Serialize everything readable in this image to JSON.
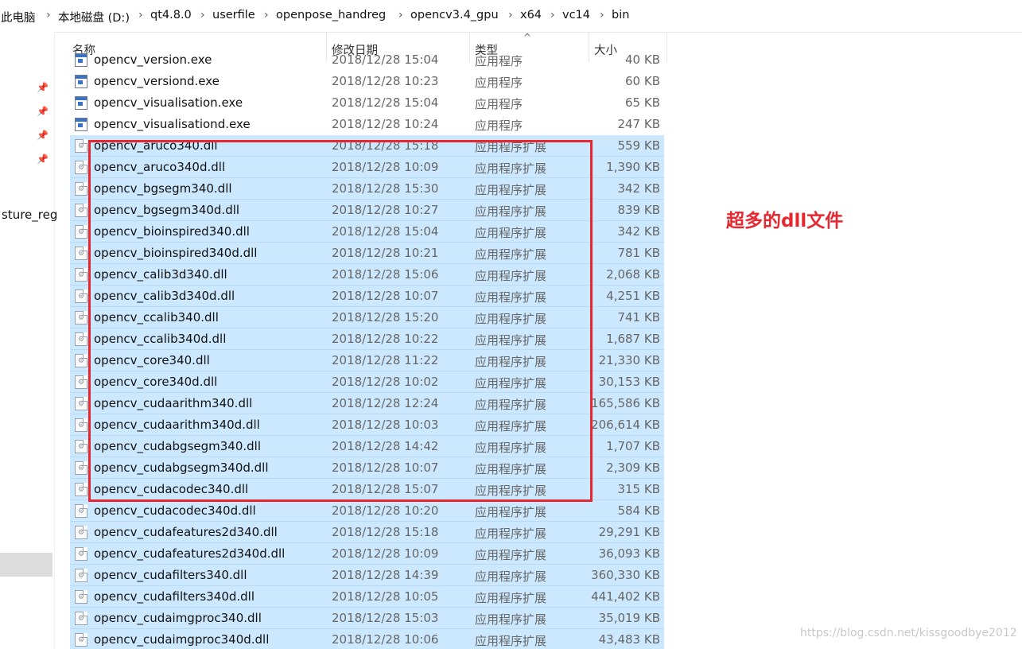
{
  "breadcrumb": [
    "此电脑",
    "本地磁盘 (D:)",
    "qt4.8.0",
    "userfile",
    "openpose_handreg",
    "opencv3.4_gpu",
    "x64",
    "vc14",
    "bin"
  ],
  "nav": {
    "partial_item": "sture_reg"
  },
  "columns": {
    "name": "名称",
    "date": "修改日期",
    "type": "类型",
    "size": "大小"
  },
  "files": [
    {
      "name": "opencv_version.exe",
      "date": "2018/12/28 15:04",
      "type": "应用程序",
      "size": "40 KB",
      "icon": "exe-icon",
      "selected": false
    },
    {
      "name": "opencv_versiond.exe",
      "date": "2018/12/28 10:23",
      "type": "应用程序",
      "size": "60 KB",
      "icon": "exe-icon",
      "selected": false
    },
    {
      "name": "opencv_visualisation.exe",
      "date": "2018/12/28 15:04",
      "type": "应用程序",
      "size": "65 KB",
      "icon": "exe-icon",
      "selected": false
    },
    {
      "name": "opencv_visualisationd.exe",
      "date": "2018/12/28 10:24",
      "type": "应用程序",
      "size": "247 KB",
      "icon": "exe-icon",
      "selected": false
    },
    {
      "name": "opencv_aruco340.dll",
      "date": "2018/12/28 15:18",
      "type": "应用程序扩展",
      "size": "559 KB",
      "icon": "dll-icon",
      "selected": true
    },
    {
      "name": "opencv_aruco340d.dll",
      "date": "2018/12/28 10:09",
      "type": "应用程序扩展",
      "size": "1,390 KB",
      "icon": "dll-icon",
      "selected": true
    },
    {
      "name": "opencv_bgsegm340.dll",
      "date": "2018/12/28 15:30",
      "type": "应用程序扩展",
      "size": "342 KB",
      "icon": "dll-icon",
      "selected": true
    },
    {
      "name": "opencv_bgsegm340d.dll",
      "date": "2018/12/28 10:27",
      "type": "应用程序扩展",
      "size": "839 KB",
      "icon": "dll-icon",
      "selected": true
    },
    {
      "name": "opencv_bioinspired340.dll",
      "date": "2018/12/28 15:04",
      "type": "应用程序扩展",
      "size": "342 KB",
      "icon": "dll-icon",
      "selected": true
    },
    {
      "name": "opencv_bioinspired340d.dll",
      "date": "2018/12/28 10:21",
      "type": "应用程序扩展",
      "size": "781 KB",
      "icon": "dll-icon",
      "selected": true
    },
    {
      "name": "opencv_calib3d340.dll",
      "date": "2018/12/28 15:06",
      "type": "应用程序扩展",
      "size": "2,068 KB",
      "icon": "dll-icon",
      "selected": true
    },
    {
      "name": "opencv_calib3d340d.dll",
      "date": "2018/12/28 10:07",
      "type": "应用程序扩展",
      "size": "4,251 KB",
      "icon": "dll-icon",
      "selected": true
    },
    {
      "name": "opencv_ccalib340.dll",
      "date": "2018/12/28 15:20",
      "type": "应用程序扩展",
      "size": "741 KB",
      "icon": "dll-icon",
      "selected": true
    },
    {
      "name": "opencv_ccalib340d.dll",
      "date": "2018/12/28 10:22",
      "type": "应用程序扩展",
      "size": "1,687 KB",
      "icon": "dll-icon",
      "selected": true
    },
    {
      "name": "opencv_core340.dll",
      "date": "2018/12/28 11:22",
      "type": "应用程序扩展",
      "size": "21,330 KB",
      "icon": "dll-icon",
      "selected": true
    },
    {
      "name": "opencv_core340d.dll",
      "date": "2018/12/28 10:02",
      "type": "应用程序扩展",
      "size": "30,153 KB",
      "icon": "dll-icon",
      "selected": true
    },
    {
      "name": "opencv_cudaarithm340.dll",
      "date": "2018/12/28 12:24",
      "type": "应用程序扩展",
      "size": "165,586 KB",
      "icon": "dll-icon",
      "selected": true
    },
    {
      "name": "opencv_cudaarithm340d.dll",
      "date": "2018/12/28 10:03",
      "type": "应用程序扩展",
      "size": "206,614 KB",
      "icon": "dll-icon",
      "selected": true
    },
    {
      "name": "opencv_cudabgsegm340.dll",
      "date": "2018/12/28 14:42",
      "type": "应用程序扩展",
      "size": "1,707 KB",
      "icon": "dll-icon",
      "selected": true
    },
    {
      "name": "opencv_cudabgsegm340d.dll",
      "date": "2018/12/28 10:07",
      "type": "应用程序扩展",
      "size": "2,309 KB",
      "icon": "dll-icon",
      "selected": true
    },
    {
      "name": "opencv_cudacodec340.dll",
      "date": "2018/12/28 15:07",
      "type": "应用程序扩展",
      "size": "315 KB",
      "icon": "dll-icon",
      "selected": true
    },
    {
      "name": "opencv_cudacodec340d.dll",
      "date": "2018/12/28 10:20",
      "type": "应用程序扩展",
      "size": "584 KB",
      "icon": "dll-icon",
      "selected": true
    },
    {
      "name": "opencv_cudafeatures2d340.dll",
      "date": "2018/12/28 15:18",
      "type": "应用程序扩展",
      "size": "29,291 KB",
      "icon": "dll-icon",
      "selected": true
    },
    {
      "name": "opencv_cudafeatures2d340d.dll",
      "date": "2018/12/28 10:09",
      "type": "应用程序扩展",
      "size": "36,093 KB",
      "icon": "dll-icon",
      "selected": true
    },
    {
      "name": "opencv_cudafilters340.dll",
      "date": "2018/12/28 14:39",
      "type": "应用程序扩展",
      "size": "360,330 KB",
      "icon": "dll-icon",
      "selected": true
    },
    {
      "name": "opencv_cudafilters340d.dll",
      "date": "2018/12/28 10:05",
      "type": "应用程序扩展",
      "size": "441,402 KB",
      "icon": "dll-icon",
      "selected": true
    },
    {
      "name": "opencv_cudaimgproc340.dll",
      "date": "2018/12/28 15:03",
      "type": "应用程序扩展",
      "size": "35,019 KB",
      "icon": "dll-icon",
      "selected": true
    },
    {
      "name": "opencv_cudaimgproc340d.dll",
      "date": "2018/12/28 10:06",
      "type": "应用程序扩展",
      "size": "43,483 KB",
      "icon": "dll-icon",
      "selected": true
    }
  ],
  "annotation": {
    "text": "超多的dll文件",
    "color": "#e8262f"
  },
  "watermark": "https://blog.csdn.net/kissgoodbye2012",
  "colors": {
    "selection": "#cce8ff",
    "accent_red": "#e8262f"
  }
}
